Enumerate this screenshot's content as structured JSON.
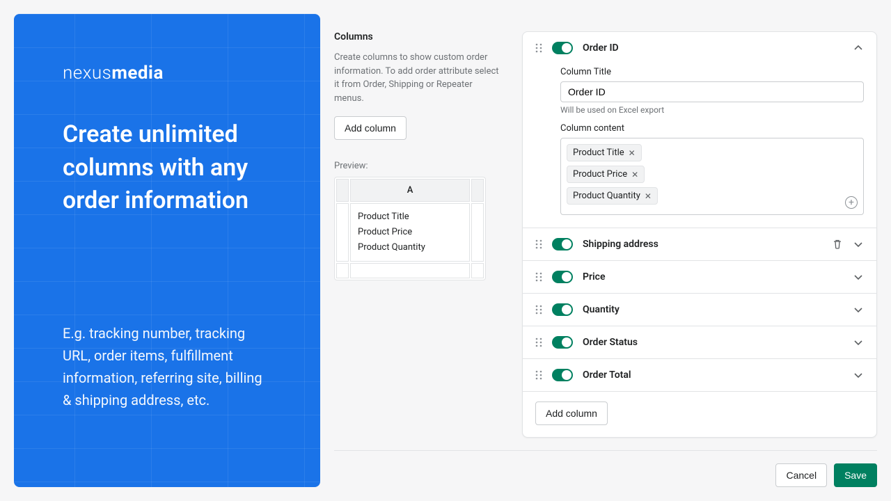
{
  "promo": {
    "brand_thin": "nexus",
    "brand_bold": "media",
    "headline": "Create unlimited columns with any order information",
    "subtext": "E.g. tracking number, tracking URL, order items, fulfillment information, referring site, billing & shipping address, etc."
  },
  "left": {
    "title": "Columns",
    "sub": "Create columns to show custom order information. To add order attribute select it from Order, Shipping or Repeater menus.",
    "add_btn": "Add column",
    "preview_label": "Preview:",
    "preview_header": "A",
    "preview_cells": [
      "Product Title",
      "Product Price",
      "Product Quantity"
    ]
  },
  "editor": {
    "column_title_label": "Column Title",
    "column_title_value": "Order ID",
    "column_title_hint": "Will be used on Excel export",
    "content_label": "Column content",
    "tags": [
      "Product Title",
      "Product Price",
      "Product Quantity"
    ]
  },
  "columns": [
    {
      "name": "Order ID",
      "expanded": true
    },
    {
      "name": "Shipping address",
      "trash": true
    },
    {
      "name": "Price"
    },
    {
      "name": "Quantity"
    },
    {
      "name": "Order Status"
    },
    {
      "name": "Order Total"
    }
  ],
  "footer_add": "Add column",
  "buttons": {
    "cancel": "Cancel",
    "save": "Save"
  }
}
